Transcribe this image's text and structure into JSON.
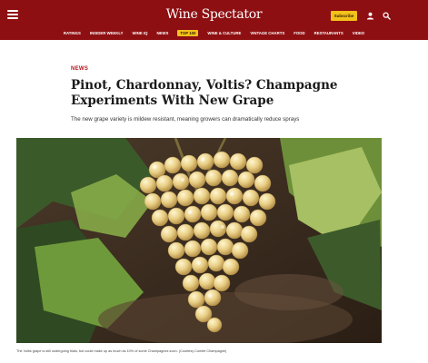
{
  "site": {
    "logo_text": "Wine Spectator",
    "subscribe_label": "Subscribe",
    "brand_color": "#8e0f12",
    "accent_color": "#f2c21b"
  },
  "nav": {
    "items": [
      {
        "label": "RATINGS"
      },
      {
        "label": "INSIDER WEEKLY"
      },
      {
        "label": "WINE IQ"
      },
      {
        "label": "NEWS"
      },
      {
        "label": "TOP 100",
        "highlighted": true
      },
      {
        "label": "WINE & CULTURE"
      },
      {
        "label": "VINTAGE CHARTS"
      },
      {
        "label": "FOOD"
      },
      {
        "label": "RESTAURANTS"
      },
      {
        "label": "VIDEO"
      }
    ]
  },
  "icons": {
    "menu": "menu-icon",
    "user": "user-icon",
    "search": "search-icon"
  },
  "article": {
    "section": "NEWS",
    "headline": "Pinot, Chardonnay, Voltis? Champagne Experiments With New Grape",
    "dek": "The new grape variety is mildew resistant, meaning growers can dramatically reduce sprays",
    "image_caption": "The Voltis grape is still undergoing trials, but could make up as much as 10% of some Champagnes soon. (Courtesy Comité Champagne)"
  }
}
